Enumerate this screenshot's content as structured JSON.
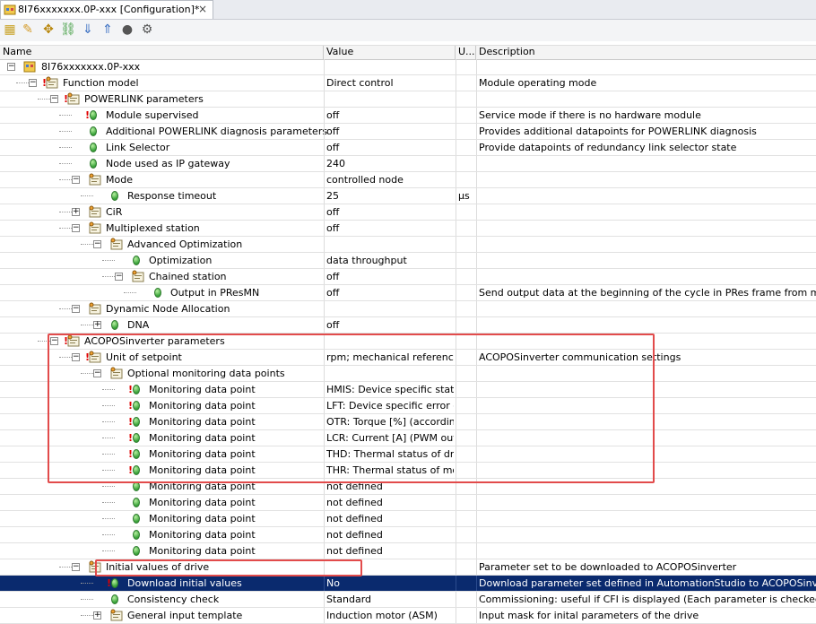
{
  "tab": {
    "title": "8I76xxxxxxx.0P-xxx [Configuration]*",
    "close": "×"
  },
  "toolbar": {
    "icons": [
      "new-item-icon",
      "open-icon",
      "move-icon",
      "link-icon",
      "sort-down-icon",
      "sort-up-icon",
      "record-icon",
      "settings-icon"
    ]
  },
  "columns": {
    "name": "Name",
    "value": "Value",
    "unit": "U...",
    "description": "Description"
  },
  "rows": [
    {
      "level": 0,
      "type": "root",
      "expander": "minus",
      "warn": false,
      "name": "8I76xxxxxxx.0P-xxx",
      "value": "",
      "unit": "",
      "desc": ""
    },
    {
      "level": 1,
      "type": "folder",
      "expander": "minus",
      "warn": true,
      "name": "Function model",
      "value": "Direct control",
      "unit": "",
      "desc": "Module operating mode"
    },
    {
      "level": 2,
      "type": "folder",
      "expander": "minus",
      "warn": true,
      "name": "POWERLINK parameters",
      "value": "",
      "unit": "",
      "desc": ""
    },
    {
      "level": 3,
      "type": "leaf",
      "expander": "",
      "warn": true,
      "name": "Module supervised",
      "value": "off",
      "unit": "",
      "desc": "Service mode if there is no hardware module"
    },
    {
      "level": 3,
      "type": "leaf",
      "expander": "",
      "warn": false,
      "name": "Additional POWERLINK diagnosis parameters",
      "value": "off",
      "unit": "",
      "desc": "Provides additional datapoints for POWERLINK diagnosis"
    },
    {
      "level": 3,
      "type": "leaf",
      "expander": "",
      "warn": false,
      "name": "Link Selector",
      "value": "off",
      "unit": "",
      "desc": "Provide datapoints of redundancy link selector state"
    },
    {
      "level": 3,
      "type": "leaf",
      "expander": "",
      "warn": false,
      "name": "Node used as IP gateway",
      "value": "240",
      "unit": "",
      "desc": ""
    },
    {
      "level": 3,
      "type": "folder",
      "expander": "minus",
      "warn": false,
      "name": "Mode",
      "value": "controlled node",
      "unit": "",
      "desc": ""
    },
    {
      "level": 4,
      "type": "leaf",
      "expander": "",
      "warn": false,
      "name": "Response timeout",
      "value": "25",
      "unit": "µs",
      "desc": ""
    },
    {
      "level": 3,
      "type": "folder",
      "expander": "plus",
      "warn": false,
      "name": "CiR",
      "value": "off",
      "unit": "",
      "desc": ""
    },
    {
      "level": 3,
      "type": "folder",
      "expander": "minus",
      "warn": false,
      "name": "Multiplexed station",
      "value": "off",
      "unit": "",
      "desc": ""
    },
    {
      "level": 4,
      "type": "folder",
      "expander": "minus",
      "warn": false,
      "name": "Advanced Optimization",
      "value": "",
      "unit": "",
      "desc": ""
    },
    {
      "level": 5,
      "type": "leaf",
      "expander": "",
      "warn": false,
      "name": "Optimization",
      "value": "data throughput",
      "unit": "",
      "desc": ""
    },
    {
      "level": 5,
      "type": "folder",
      "expander": "minus",
      "warn": false,
      "name": "Chained station",
      "value": "off",
      "unit": "",
      "desc": ""
    },
    {
      "level": 6,
      "type": "leaf",
      "expander": "",
      "warn": false,
      "name": "Output in PResMN",
      "value": "off",
      "unit": "",
      "desc": "Send output data at the beginning of the cycle in PRes frame from managing node"
    },
    {
      "level": 3,
      "type": "folder",
      "expander": "minus",
      "warn": false,
      "name": "Dynamic Node Allocation",
      "value": "",
      "unit": "",
      "desc": ""
    },
    {
      "level": 4,
      "type": "leaf",
      "expander": "plus",
      "warn": false,
      "name": "DNA",
      "value": "off",
      "unit": "",
      "desc": ""
    },
    {
      "level": 2,
      "type": "folder",
      "expander": "minus",
      "warn": true,
      "name": "ACOPOSinverter parameters",
      "value": "",
      "unit": "",
      "desc": ""
    },
    {
      "level": 3,
      "type": "folder",
      "expander": "minus",
      "warn": true,
      "name": "Unit of setpoint",
      "value": "rpm; mechanical references...",
      "unit": "",
      "desc": "ACOPOSinverter communication settings"
    },
    {
      "level": 4,
      "type": "folder",
      "expander": "minus",
      "warn": false,
      "name": "Optional monitoring data points",
      "value": "",
      "unit": "",
      "desc": ""
    },
    {
      "level": 5,
      "type": "leaf",
      "expander": "",
      "warn": true,
      "name": "Monitoring data point",
      "value": "HMIS: Device specific statu...",
      "unit": "",
      "desc": ""
    },
    {
      "level": 5,
      "type": "leaf",
      "expander": "",
      "warn": true,
      "name": "Monitoring data point",
      "value": "LFT: Device specific error c...",
      "unit": "",
      "desc": ""
    },
    {
      "level": 5,
      "type": "leaf",
      "expander": "",
      "warn": true,
      "name": "Monitoring data point",
      "value": "OTR: Torque [%] (accordin...",
      "unit": "",
      "desc": ""
    },
    {
      "level": 5,
      "type": "leaf",
      "expander": "",
      "warn": true,
      "name": "Monitoring data point",
      "value": "LCR: Current [A] (PWM out...",
      "unit": "",
      "desc": ""
    },
    {
      "level": 5,
      "type": "leaf",
      "expander": "",
      "warn": true,
      "name": "Monitoring data point",
      "value": "THD: Thermal status of driv...",
      "unit": "",
      "desc": ""
    },
    {
      "level": 5,
      "type": "leaf",
      "expander": "",
      "warn": true,
      "name": "Monitoring data point",
      "value": "THR: Thermal status of mot...",
      "unit": "",
      "desc": ""
    },
    {
      "level": 5,
      "type": "leaf",
      "expander": "",
      "warn": false,
      "name": "Monitoring data point",
      "value": "not defined",
      "unit": "",
      "desc": ""
    },
    {
      "level": 5,
      "type": "leaf",
      "expander": "",
      "warn": false,
      "name": "Monitoring data point",
      "value": "not defined",
      "unit": "",
      "desc": ""
    },
    {
      "level": 5,
      "type": "leaf",
      "expander": "",
      "warn": false,
      "name": "Monitoring data point",
      "value": "not defined",
      "unit": "",
      "desc": ""
    },
    {
      "level": 5,
      "type": "leaf",
      "expander": "",
      "warn": false,
      "name": "Monitoring data point",
      "value": "not defined",
      "unit": "",
      "desc": ""
    },
    {
      "level": 5,
      "type": "leaf",
      "expander": "",
      "warn": false,
      "name": "Monitoring data point",
      "value": "not defined",
      "unit": "",
      "desc": ""
    },
    {
      "level": 3,
      "type": "folder",
      "expander": "minus",
      "warn": false,
      "name": "Initial values of drive",
      "value": "",
      "unit": "",
      "desc": "Parameter set to be downloaded to ACOPOSinverter"
    },
    {
      "level": 4,
      "type": "leaf",
      "expander": "",
      "warn": true,
      "selected": true,
      "name": "Download initial values",
      "value": "No",
      "unit": "",
      "desc": "Download parameter set defined in AutomationStudio to ACOPOSinverter"
    },
    {
      "level": 4,
      "type": "leaf",
      "expander": "",
      "warn": false,
      "name": "Consistency check",
      "value": "Standard",
      "unit": "",
      "desc": "Commissioning: useful if CFI is displayed (Each parameter is checked individually)"
    },
    {
      "level": 4,
      "type": "folder",
      "expander": "plus",
      "warn": false,
      "name": "General input template",
      "value": "Induction motor (ASM)",
      "unit": "",
      "desc": "Input mask for inital parameters of the drive"
    }
  ]
}
